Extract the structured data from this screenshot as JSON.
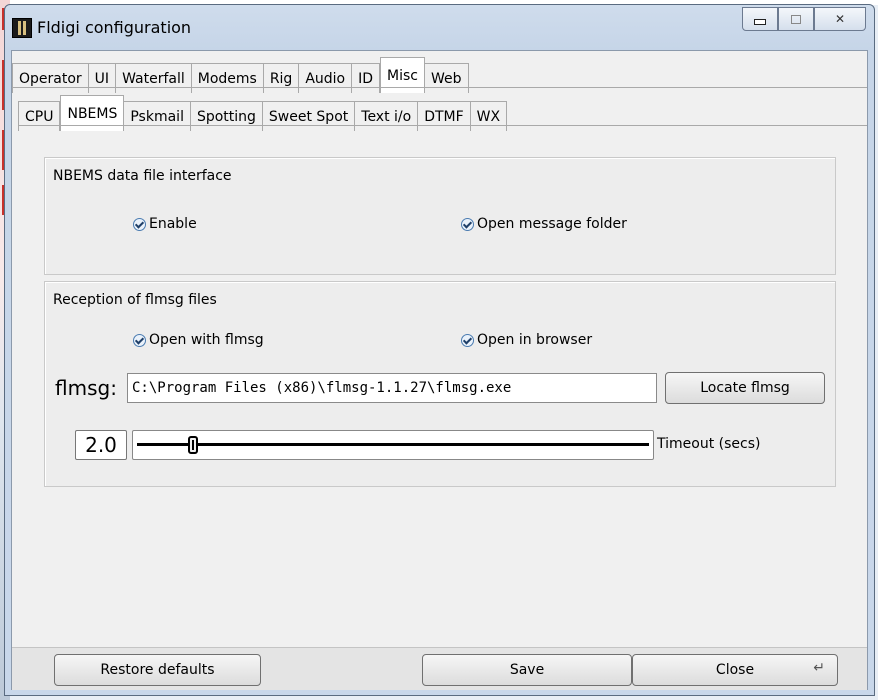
{
  "window": {
    "title": "Fldigi configuration"
  },
  "titlebar_buttons": {
    "minimize": "minimize",
    "maximize": "maximize",
    "close": "close"
  },
  "tabs_main": [
    {
      "label": "Operator"
    },
    {
      "label": "UI"
    },
    {
      "label": "Waterfall"
    },
    {
      "label": "Modems"
    },
    {
      "label": "Rig"
    },
    {
      "label": "Audio"
    },
    {
      "label": "ID"
    },
    {
      "label": "Misc",
      "active": true
    },
    {
      "label": "Web"
    }
  ],
  "tabs_sub": [
    {
      "label": "CPU"
    },
    {
      "label": "NBEMS",
      "active": true
    },
    {
      "label": "Pskmail"
    },
    {
      "label": "Spotting"
    },
    {
      "label": "Sweet Spot"
    },
    {
      "label": "Text i/o"
    },
    {
      "label": "DTMF"
    },
    {
      "label": "WX"
    }
  ],
  "nbems_group": {
    "title": "NBEMS data file interface",
    "enable_label": "Enable",
    "enable_checked": true,
    "open_folder_label": "Open message folder",
    "open_folder_checked": true
  },
  "reception_group": {
    "title": "Reception of flmsg files",
    "open_flmsg_label": "Open with flmsg",
    "open_flmsg_checked": true,
    "open_browser_label": "Open in browser",
    "open_browser_checked": true,
    "flmsg_label": "flmsg:",
    "flmsg_path": "C:\\Program Files (x86)\\flmsg-1.1.27\\flmsg.exe",
    "locate_button": "Locate flmsg",
    "timeout_value": "2.0",
    "timeout_label": "Timeout (secs)"
  },
  "footer": {
    "restore_defaults": "Restore defaults",
    "save": "Save",
    "close": "Close"
  },
  "colors": {
    "accent": "#4a7bb0",
    "window_frame": "#c6d5e8"
  },
  "icons": {
    "app": "fldigi-app-icon",
    "checkbox": "checkmark-icon",
    "return": "return-arrow-icon"
  }
}
